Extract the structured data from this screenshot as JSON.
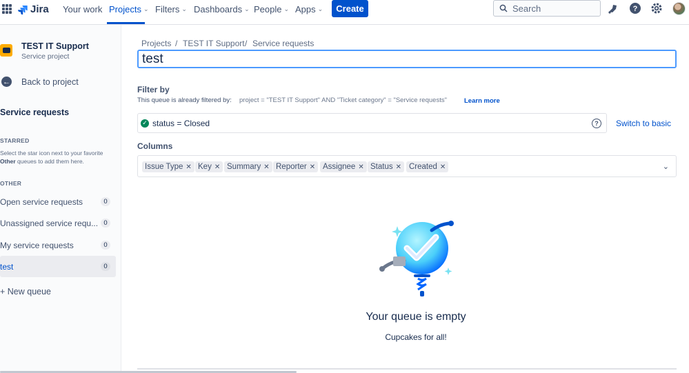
{
  "nav": {
    "product": "Jira",
    "items": [
      {
        "label": "Your work",
        "caret": false
      },
      {
        "label": "Projects",
        "caret": true
      },
      {
        "label": "Filters",
        "caret": true
      },
      {
        "label": "Dashboards",
        "caret": true
      },
      {
        "label": "People",
        "caret": true
      },
      {
        "label": "Apps",
        "caret": true
      }
    ],
    "create_label": "Create",
    "search_placeholder": "Search",
    "icons": [
      "app-switcher-icon",
      "notifications-icon",
      "help-icon",
      "settings-icon",
      "profile-avatar"
    ]
  },
  "sidebar": {
    "project_name": "TEST IT Support",
    "project_type": "Service project",
    "back_label": "Back to project",
    "section_title": "Service requests",
    "starred_heading": "STARRED",
    "starred_help_pre": "Select the star icon next to your favorite ",
    "starred_help_bold": "Other",
    "starred_help_post": " queues to add them here.",
    "other_heading": "OTHER",
    "queues": [
      {
        "label": "Open service requests",
        "count": "0"
      },
      {
        "label": "Unassigned service requ...",
        "count": "0"
      },
      {
        "label": "My service requests",
        "count": "0"
      },
      {
        "label": "test",
        "count": "0"
      }
    ],
    "new_queue_label": "+ New queue"
  },
  "main": {
    "breadcrumbs": [
      "Projects",
      "TEST IT Support",
      "Service requests"
    ],
    "queue_name_value": "test",
    "filter_heading": "Filter by",
    "filter_note": "This queue is already filtered by:",
    "filter_jql": "project = \"TEST IT Support\" AND \"Ticket category\" = \"Service requests\"",
    "learn_more": "Learn more",
    "jql_value": "status = Closed",
    "switch_basic": "Switch to basic",
    "columns_heading": "Columns",
    "columns": [
      "Issue Type",
      "Key",
      "Summary",
      "Reporter",
      "Assignee",
      "Status",
      "Created"
    ],
    "empty_title": "Your queue is empty",
    "empty_subtitle": "Cupcakes for all!"
  },
  "colors": {
    "accent": "#0052CC",
    "focus": "#4C9AFF",
    "success": "#00875A"
  }
}
